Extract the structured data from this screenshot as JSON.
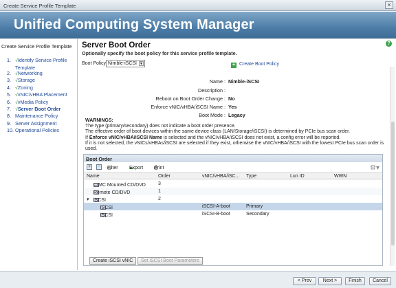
{
  "window": {
    "title": "Create Service Profile Template",
    "close_glyph": "×"
  },
  "banner": {
    "title": "Unified Computing System Manager"
  },
  "sidebar": {
    "title": "Create Service Profile Template",
    "steps": [
      {
        "num": "1.",
        "check": "√",
        "label": "Identify Service Profile Template"
      },
      {
        "num": "2.",
        "check": "√",
        "label": "Networking"
      },
      {
        "num": "3.",
        "check": "√",
        "label": "Storage"
      },
      {
        "num": "4.",
        "check": "√",
        "label": "Zoning"
      },
      {
        "num": "5.",
        "check": "√",
        "label": "vNIC/vHBA Placement"
      },
      {
        "num": "6.",
        "check": "√",
        "label": "vMedia Policy"
      },
      {
        "num": "7.",
        "check": "√",
        "label": "Server Boot Order"
      },
      {
        "num": "8.",
        "check": "",
        "label": "Maintenance Policy"
      },
      {
        "num": "9.",
        "check": "",
        "label": "Server Assignment"
      },
      {
        "num": "10.",
        "check": "",
        "label": "Operational Policies"
      }
    ]
  },
  "main": {
    "title": "Server Boot Order",
    "subtitle": "Optionally specify the boot policy for this service profile template.",
    "help_glyph": "?",
    "boot_policy_label": "Boot Policy:",
    "boot_policy_value": "Nimble-iSCSI",
    "create_boot_policy": "Create Boot Policy",
    "plus_glyph": "+",
    "props": [
      {
        "k": "Name :",
        "v": "Nimble-iSCSI"
      },
      {
        "k": "Description :",
        "v": ""
      },
      {
        "k": "Reboot on Boot Order Change :",
        "v": "No"
      },
      {
        "k": "Enforce vNIC/vHBA/iSCSI Name :",
        "v": "Yes"
      },
      {
        "k": "Boot Mode :",
        "v": "Legacy"
      }
    ],
    "warnings": {
      "title": "WARNINGS:",
      "l1": "The type (primary/secondary) does not indicate a boot order presence.",
      "l2": "The effective order of boot devices within the same device class (LAN/Storage/iSCSI) is determined by PCIe bus scan order.",
      "l3a": "If ",
      "l3b": "Enforce vNIC/vHBA/iSCSI Name",
      "l3c": " is selected and the vNIC/vHBA/iSCSI does not exist, a config error will be reported.",
      "l4": "If it is not selected, the vNICs/vHBAs/iSCSI are selected if they exist, otherwise the vNIC/vHBA/iSCSI with the lowest PCIe bus scan order is used."
    },
    "boot_order": {
      "title": "Boot Order",
      "toolbar": {
        "add": "+",
        "remove": "−",
        "filter": "Filter",
        "export": "Export",
        "print": "Print"
      },
      "columns": [
        "Name",
        "Order",
        "vNIC/vHBA/iSC...",
        "Type",
        "Lun ID",
        "WWN"
      ],
      "rows": [
        {
          "name": "CIMC Mounted CD/DVD",
          "order": "3",
          "vnic": "",
          "type": ""
        },
        {
          "name": "Remote CD/DVD",
          "order": "1",
          "vnic": "",
          "type": ""
        },
        {
          "name": "iSCSI",
          "order": "2",
          "vnic": "",
          "type": "",
          "expander": "▾"
        },
        {
          "name": "iSCSI",
          "order": "",
          "vnic": "iSCSI-A-boot",
          "type": "Primary"
        },
        {
          "name": "iSCSI",
          "order": "",
          "vnic": "iSCSI-B-boot",
          "type": "Secondary"
        }
      ],
      "create_iscsi_vnic": "Create iSCSI vNIC",
      "set_iscsi_boot": "Set iSCSI Boot Parameters"
    }
  },
  "footer": {
    "prev": "< Prev",
    "next": "Next >",
    "finish": "Finish",
    "cancel": "Cancel"
  },
  "colors": {
    "banner": "#4e7ea8",
    "check": "#3a9a3a",
    "link": "#1f4a9a",
    "selected_row": "#c5d6ea"
  }
}
